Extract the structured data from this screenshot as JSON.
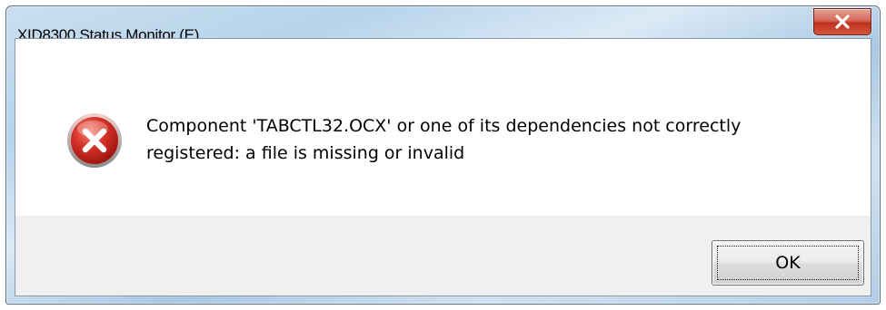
{
  "window": {
    "title": "XID8300 Status Monitor (E)",
    "close_icon": "close-x-icon"
  },
  "dialog": {
    "icon": "error-icon",
    "message_line1": "Component 'TABCTL32.OCX' or one of its dependencies not correctly",
    "message_line2": "registered: a file is missing or invalid",
    "ok_label": "OK"
  },
  "colors": {
    "close_button": "#c0311f",
    "error_icon": "#c8261e"
  }
}
